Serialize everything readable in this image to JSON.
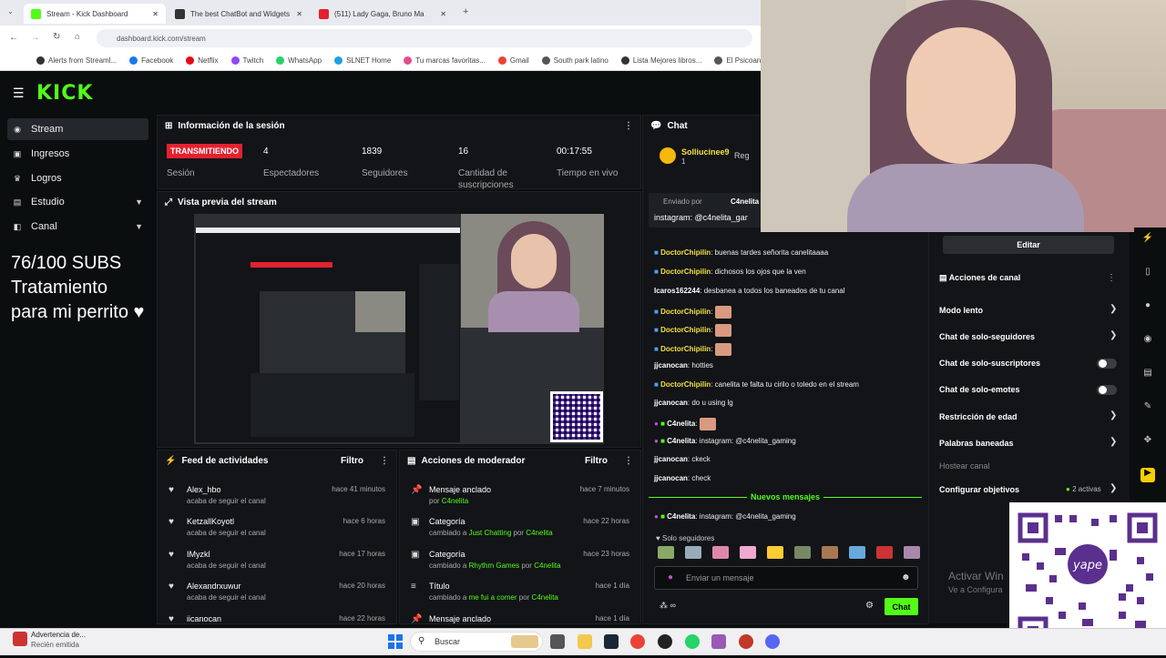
{
  "browser": {
    "tabs": [
      {
        "title": "Stream - Kick Dashboard",
        "active": true,
        "color": "#53fc18"
      },
      {
        "title": "The best ChatBot and Widgets",
        "active": false,
        "color": "#333333"
      },
      {
        "title": "(511) Lady Gaga, Bruno Ma",
        "active": false,
        "color": "#e5212f"
      }
    ],
    "url": "dashboard.kick.com/stream",
    "bookmarks": [
      "Alerts from Streaml...",
      "Facebook",
      "Netflix",
      "Twitch",
      "WhatsApp",
      "SLNET Home",
      "Tu marcas favoritas...",
      "Gmail",
      "South park latino",
      "Lista Mejores libros...",
      "El Psicoana..."
    ]
  },
  "kick": {
    "logo": "KICK",
    "sidebar": [
      {
        "label": "Stream",
        "icon": "stream-icon",
        "active": true,
        "chevron": false
      },
      {
        "label": "Ingresos",
        "icon": "wallet-icon",
        "active": false,
        "chevron": false
      },
      {
        "label": "Logros",
        "icon": "trophy-icon",
        "active": false,
        "chevron": false
      },
      {
        "label": "Estudio",
        "icon": "studio-icon",
        "active": false,
        "chevron": true
      },
      {
        "label": "Canal",
        "icon": "channel-icon",
        "active": false,
        "chevron": true
      }
    ],
    "overlay_lines": [
      "76/100 SUBS",
      "Tratamiento",
      "para mi perrito ♥"
    ],
    "session": {
      "title": "Información de la sesión",
      "badge": "TRANSMITIENDO",
      "badge_label": "Sesión",
      "stats": [
        {
          "value": "4",
          "label": "Espectadores"
        },
        {
          "value": "1839",
          "label": "Seguidores"
        },
        {
          "value": "16",
          "label": "Cantidad de suscripciones"
        },
        {
          "value": "00:17:55",
          "label": "Tiempo en vivo"
        }
      ]
    },
    "preview_title": "Vista previa del stream",
    "activity": {
      "title": "Feed de actividades",
      "filter": "Filtro",
      "items": [
        {
          "name": "Alex_hbo",
          "sub": "acaba de seguir el canal",
          "time": "hace 41 minutos"
        },
        {
          "name": "KetzallKoyotl",
          "sub": "acaba de seguir el canal",
          "time": "hace 6 horas"
        },
        {
          "name": "IMyzkl",
          "sub": "acaba de seguir el canal",
          "time": "hace 17 horas"
        },
        {
          "name": "Alexandrxuwur",
          "sub": "acaba de seguir el canal",
          "time": "hace 20 horas"
        },
        {
          "name": "iicanocan",
          "sub": "",
          "time": "hace 22 horas"
        }
      ]
    },
    "moderator": {
      "title": "Acciones de moderador",
      "filter": "Filtro",
      "items": [
        {
          "name": "Mensaje anclado",
          "pre": "por",
          "hl1": "C4nelita",
          "mid": "",
          "hl2": "",
          "time": "hace 7 minutos",
          "icon": "pin-icon"
        },
        {
          "name": "Categoría",
          "pre": "cambiado a",
          "hl1": "Just Chatting",
          "mid": "por",
          "hl2": "C4nelita",
          "time": "hace 22 horas",
          "icon": "category-icon"
        },
        {
          "name": "Categoría",
          "pre": "cambiado a",
          "hl1": "Rhythm Games",
          "mid": "por",
          "hl2": "C4nelita",
          "time": "hace 23 horas",
          "icon": "category-icon"
        },
        {
          "name": "Título",
          "pre": "cambiado a",
          "hl1": "me fui a comer",
          "mid": "por",
          "hl2": "C4nelita",
          "time": "hace 1 día",
          "icon": "title-icon"
        },
        {
          "name": "Mensaje anclado",
          "pre": "",
          "hl1": "",
          "mid": "",
          "hl2": "",
          "time": "hace 1 día",
          "icon": "pin-icon"
        }
      ]
    },
    "chat": {
      "title": "Chat",
      "top_user": "Solliucinee9",
      "top_count": "1",
      "reg": "Reg",
      "pinned_by": "Enviado por",
      "pinned_user": "C4nelita",
      "pinned_text": "instagram: @c4nelita_gar",
      "messages": [
        {
          "user": "DoctorChipilin",
          "text": "buenas tardes señorita canelitaaaa"
        },
        {
          "user": "DoctorChipilin",
          "text": "dichosos los ojos que la ven"
        },
        {
          "user": "Icaros162244",
          "text": "desbanea a todos los baneados de tu canal"
        },
        {
          "user": "DoctorChipilin",
          "text": ""
        },
        {
          "user": "DoctorChipilin",
          "text": ""
        },
        {
          "user": "DoctorChipilin",
          "text": ""
        },
        {
          "user": "jjcanocan",
          "text": "hotties"
        },
        {
          "user": "DoctorChipilin",
          "text": "canelita te falta tu cirilo o toledo en el stream"
        },
        {
          "user": "jjcanocan",
          "text": "do u using lg"
        },
        {
          "user": "C4nelita",
          "text": ""
        },
        {
          "user": "C4nelita",
          "text": "instagram: @c4nelita_gaming"
        },
        {
          "user": "jjcanocan",
          "text": "ckeck"
        },
        {
          "user": "jjcanocan",
          "text": "check"
        }
      ],
      "new_messages": "Nuevos mensajes",
      "last": {
        "user": "C4nelita",
        "text": "instagram: @c4nelita_gaming"
      },
      "followers_only": "Solo seguidores",
      "input_placeholder": "Enviar un mensaje",
      "send": "Chat",
      "points": "∞"
    },
    "channel": {
      "edit": "Editar",
      "title": "Acciones de canal",
      "options": [
        {
          "label": "Modo lento",
          "kind": "arrow"
        },
        {
          "label": "Chat de solo-seguidores",
          "kind": "arrow"
        },
        {
          "label": "Chat de solo-suscriptores",
          "kind": "toggle"
        },
        {
          "label": "Chat de solo-emotes",
          "kind": "toggle"
        },
        {
          "label": "Restricción de edad",
          "kind": "arrow"
        },
        {
          "label": "Palabras baneadas",
          "kind": "arrow"
        },
        {
          "label": "Hostear canal",
          "kind": "none"
        },
        {
          "label": "Configurar objetivos",
          "kind": "arrow",
          "extra": "2 activas"
        }
      ]
    }
  },
  "windows": {
    "activate_line1": "Activar Win",
    "activate_line2": "Ve a Configura",
    "notification_title": "Advertencia de...",
    "notification_sub": "Recién emitida",
    "search": "Buscar"
  },
  "colors": {
    "accent": "#53fc18",
    "live": "#e5212f",
    "username": "#f5e042"
  }
}
